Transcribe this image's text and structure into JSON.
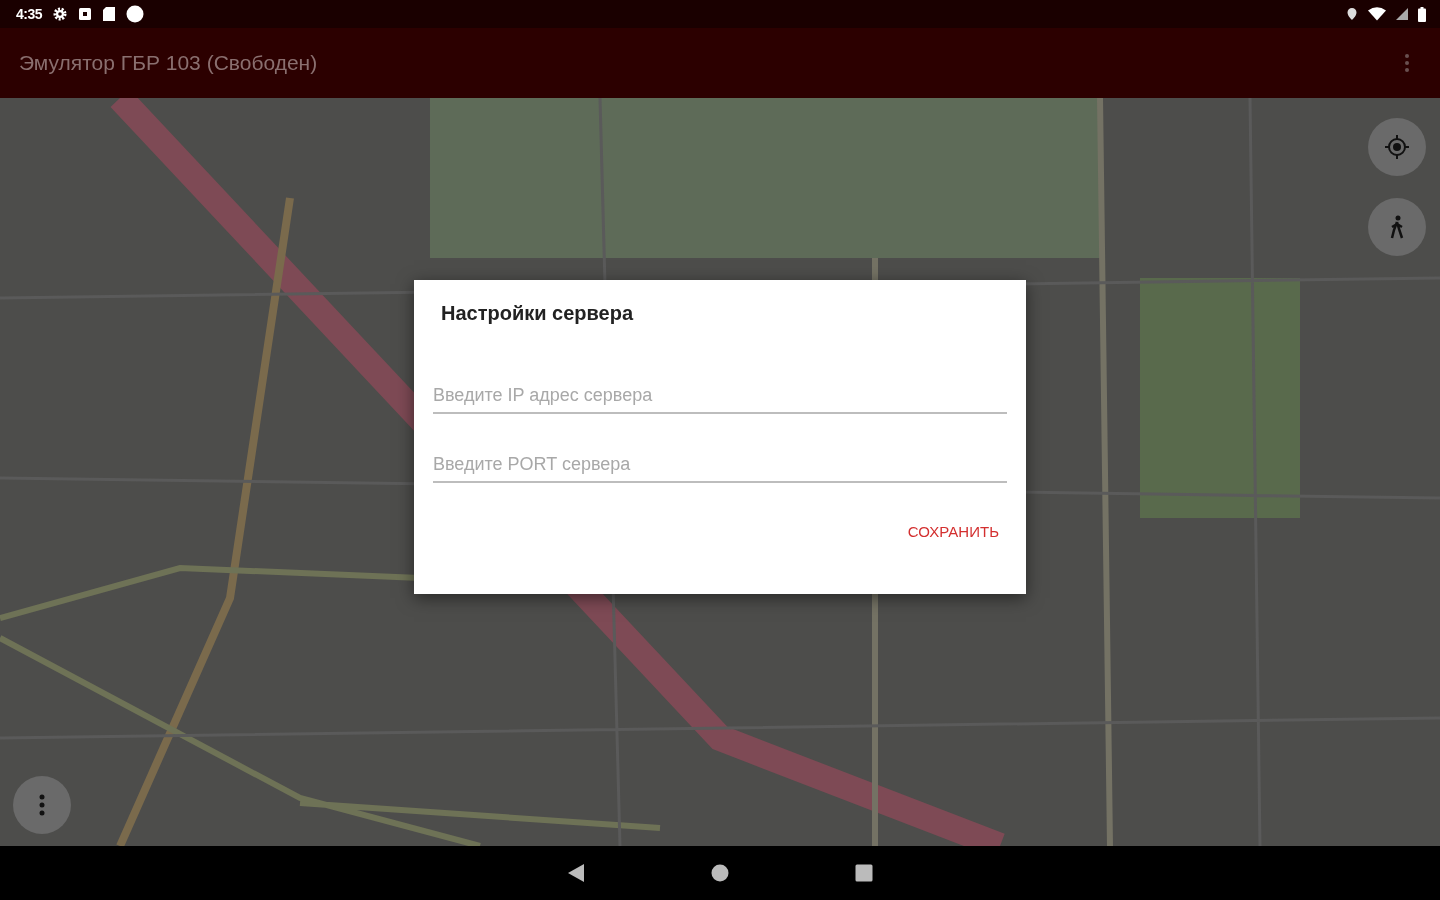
{
  "status_bar": {
    "time": "4:35"
  },
  "app_bar": {
    "title": "Эмулятор ГБР 103 (Свободен)"
  },
  "dialog": {
    "title": "Настройки сервера",
    "fields": [
      {
        "placeholder": "Введите IP адрес сервера"
      },
      {
        "placeholder": "Введите PORT сервера"
      }
    ],
    "buttons": [
      "СОХРАНИТЬ"
    ]
  }
}
